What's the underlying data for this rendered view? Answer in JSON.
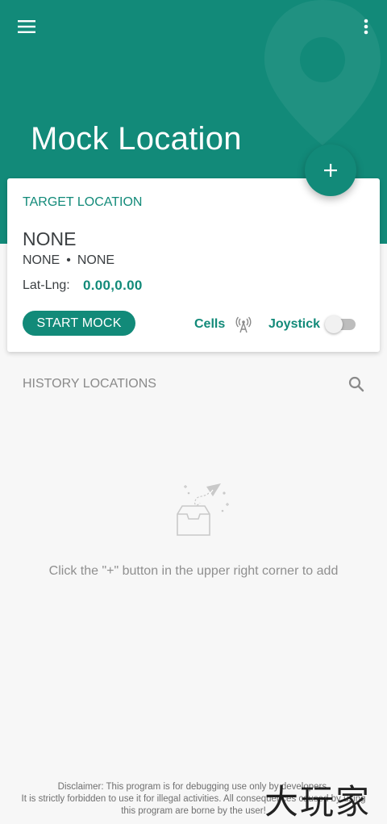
{
  "app": {
    "title": "Mock Location",
    "accent_color": "#128a79"
  },
  "toolbar": {
    "menu_icon": "hamburger-menu-icon",
    "more_icon": "more-vertical-icon",
    "fab_icon": "plus-icon"
  },
  "target": {
    "section_label": "TARGET LOCATION",
    "name": "NONE",
    "region": "NONE",
    "separator": "•",
    "city": "NONE",
    "latlng_label": "Lat-Lng:",
    "latlng_value": "0.00,0.00",
    "start_button": "START MOCK",
    "cells_label": "Cells",
    "joystick_label": "Joystick",
    "joystick_enabled": false
  },
  "history": {
    "title": "HISTORY LOCATIONS",
    "empty_message": "Click the \"+\" button in the upper right corner to add"
  },
  "footer": {
    "disclaimer_line1": "Disclaimer: This program is for debugging use only by developers.",
    "disclaimer_line2": "It is strictly forbidden to use it for illegal activities. All consequences caused by using",
    "disclaimer_line3": "this program are borne by the user!",
    "watermark": "大玩家"
  }
}
